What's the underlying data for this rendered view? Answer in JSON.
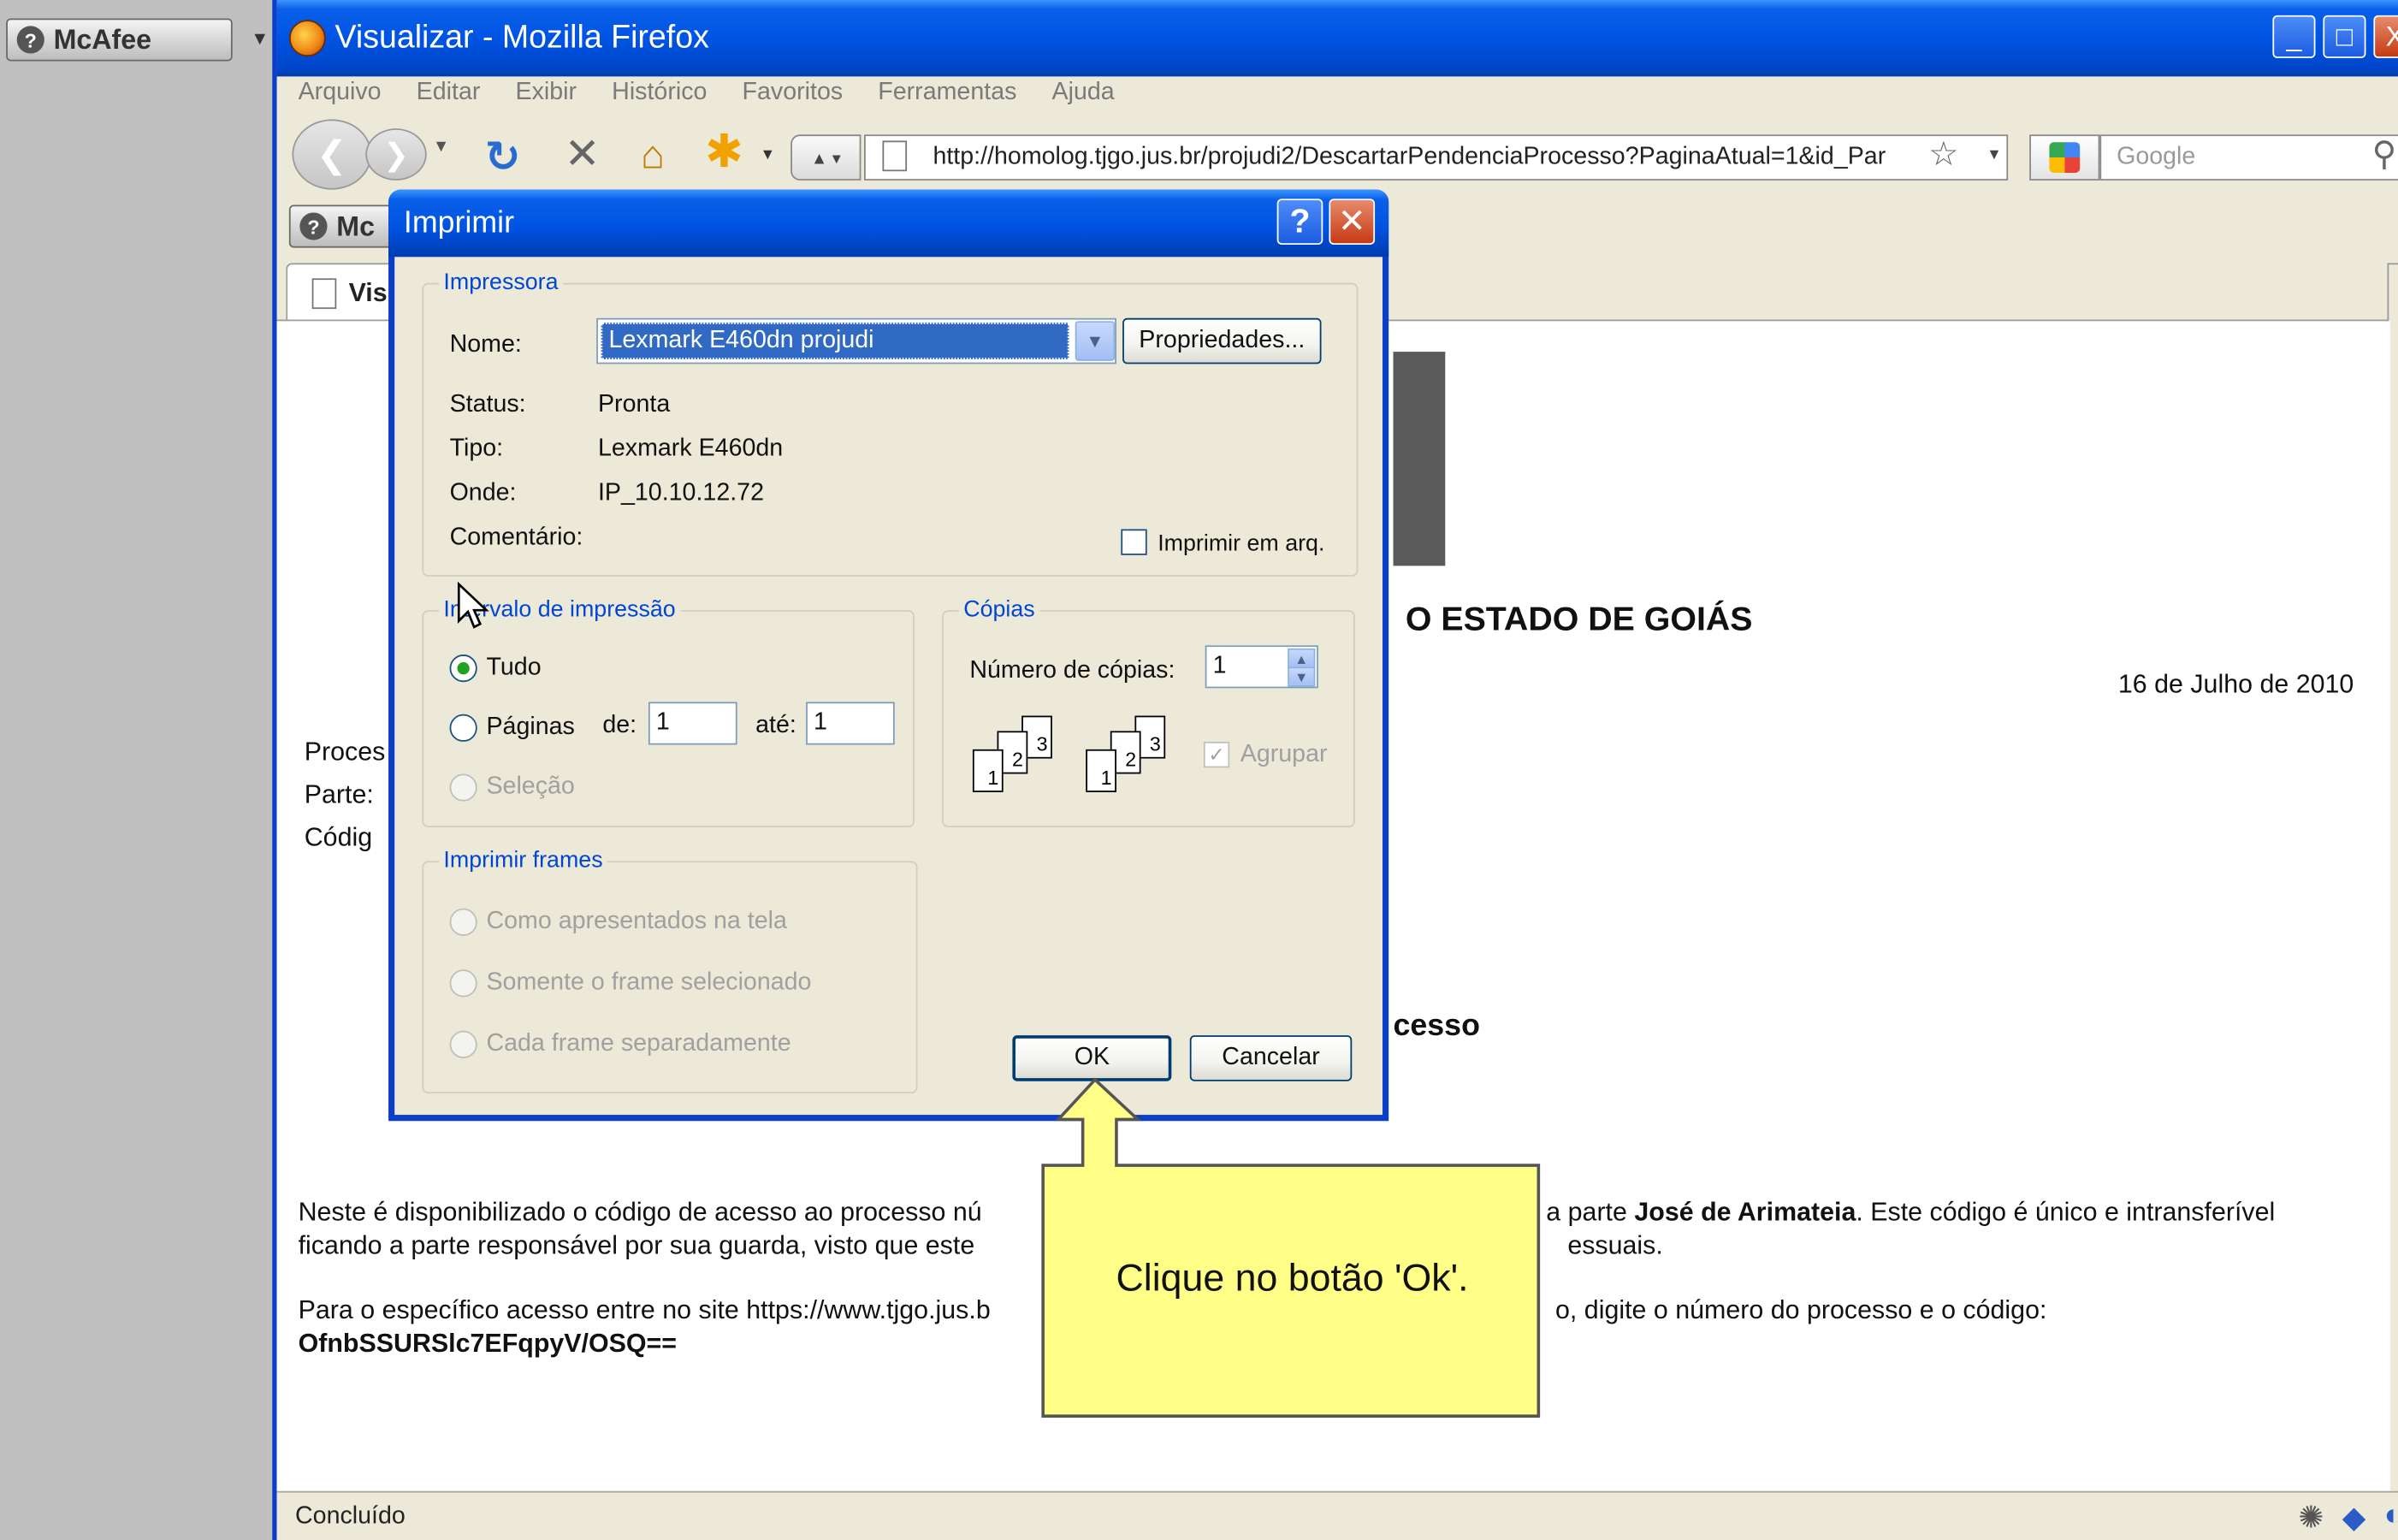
{
  "background_toolbar": {
    "mcafee_label": "McAfee",
    "help_glyph": "?"
  },
  "window": {
    "title": "Visualizar - Mozilla Firefox",
    "controls": {
      "minimize": "_",
      "maximize": "□",
      "close": "X"
    }
  },
  "menu": [
    "Arquivo",
    "Editar",
    "Exibir",
    "Histórico",
    "Favoritos",
    "Ferramentas",
    "Ajuda"
  ],
  "navbar": {
    "url": "http://homolog.tjgo.jus.br/projudi2/DescartarPendenciaProcesso?PaginaAtual=1&id_Par",
    "search_placeholder": "Google",
    "icons": [
      "back-icon",
      "forward-icon",
      "reload-icon",
      "stop-icon",
      "home-icon",
      "addon-icon",
      "bookmark-star-icon",
      "search-icon"
    ]
  },
  "inner_toolbar": {
    "mcafee_label": "Mc"
  },
  "tab": {
    "label": "Vis"
  },
  "page": {
    "heading_fragment": "O ESTADO DE GOIÁS",
    "date": "16 de Julho de 2010",
    "labels": [
      "Proces",
      "Parte:",
      "Códig"
    ],
    "section_fragment": "cesso",
    "p1_line1_a": "Neste é disponibilizado o código de acesso ao processo nú",
    "p1_line1_b": "a parte ",
    "p1_line1_bold": "José de Arimateia",
    "p1_line1_c": ". Este código é único e intransferível",
    "p1_line2_a": "ficando a parte responsável por sua guarda, visto que este",
    "p1_line2_b": "essuais.",
    "p2_line1_a": "Para o específico acesso entre no site https://www.tjgo.jus.b",
    "p2_line1_b": "o, digite o número do processo e o código:",
    "p2_code": "OfnbSSURSlc7EFqpyV/OSQ=="
  },
  "status": {
    "text": "Concluído"
  },
  "dialog": {
    "title": "Imprimir",
    "printer_group": "Impressora",
    "name_label": "Nome:",
    "printer_name": "Lexmark E460dn projudi",
    "properties_button": "Propriedades...",
    "status_label": "Status:",
    "status_value": "Pronta",
    "type_label": "Tipo:",
    "type_value": "Lexmark E460dn",
    "where_label": "Onde:",
    "where_value": "IP_10.10.12.72",
    "comment_label": "Comentário:",
    "print_to_file": "Imprimir em arq.",
    "range_group": "Intervalo de impressão",
    "range_all": "Tudo",
    "range_pages": "Páginas",
    "from_label": "de:",
    "from_value": "1",
    "to_label": "até:",
    "to_value": "1",
    "range_selection": "Seleção",
    "copies_group": "Cópias",
    "copies_label": "Número de cópias:",
    "copies_value": "1",
    "collate": "Agrupar",
    "collate_checked": true,
    "frames_group": "Imprimir frames",
    "frames_as_shown": "Como apresentados na tela",
    "frames_selected": "Somente o frame selecionado",
    "frames_each": "Cada frame separadamente",
    "ok_button": "OK",
    "cancel_button": "Cancelar"
  },
  "callout": {
    "text": "Clique no botão 'Ok'."
  }
}
